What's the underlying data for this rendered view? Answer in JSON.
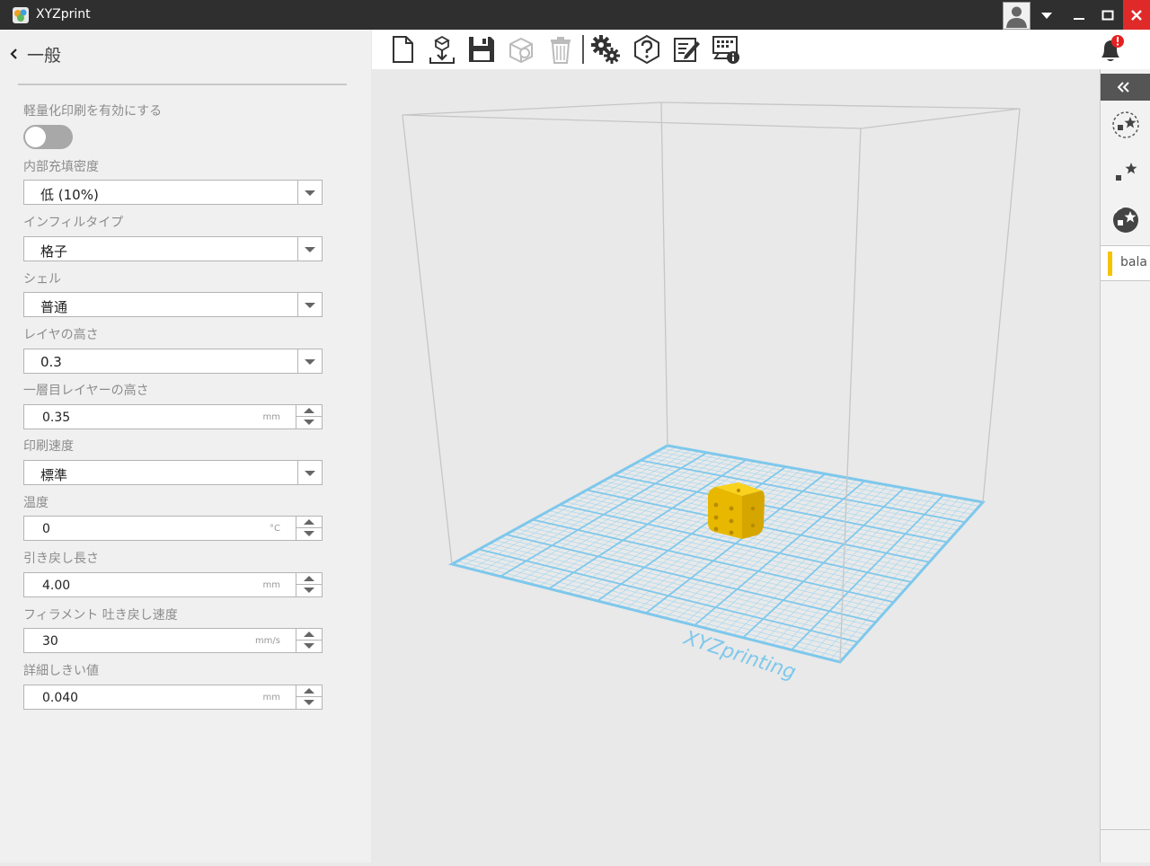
{
  "window": {
    "title": "XYZprint"
  },
  "panel": {
    "back_label": "一般",
    "lightweight_label": "軽量化印刷を有効にする",
    "infill_density": {
      "label": "内部充填密度",
      "value": "低 (10%)"
    },
    "infill_type": {
      "label": "インフィルタイプ",
      "value": "格子"
    },
    "shell": {
      "label": "シェル",
      "value": "普通"
    },
    "layer_height": {
      "label": "レイヤの高さ",
      "value": "0.3"
    },
    "first_layer_height": {
      "label": "一層目レイヤーの高さ",
      "value": "0.35",
      "unit": "mm"
    },
    "print_speed": {
      "label": "印刷速度",
      "value": "標準"
    },
    "temperature": {
      "label": "温度",
      "value": "0",
      "unit": "°C"
    },
    "retraction_length": {
      "label": "引き戻し長さ",
      "value": "4.00",
      "unit": "mm"
    },
    "retraction_speed": {
      "label": "フィラメント 吐き戻し速度",
      "value": "30",
      "unit": "mm/s"
    },
    "detail_threshold": {
      "label": "詳細しきい値",
      "value": "0.040",
      "unit": "mm"
    }
  },
  "viewport": {
    "watermark": "XYZprinting"
  },
  "side": {
    "material_tab": "bala"
  },
  "colors": {
    "accent_blue": "#7ec8ec",
    "model_yellow": "#f5c400",
    "close_red": "#e02a2a",
    "notify_red": "#e62020"
  }
}
